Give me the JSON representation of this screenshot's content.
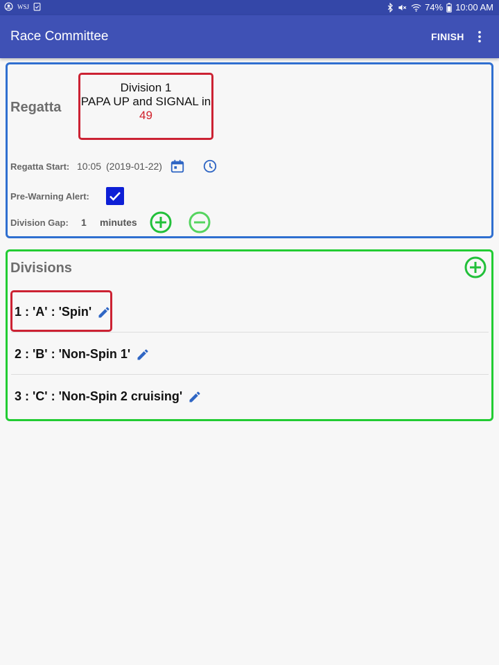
{
  "status_bar": {
    "wsj_label": "WSJ",
    "battery": "74%",
    "time": "10:00 AM"
  },
  "app_bar": {
    "title": "Race Committee",
    "finish_label": "FINISH"
  },
  "regatta": {
    "section_title": "Regatta",
    "signal_division": "Division 1",
    "signal_instruction": "PAPA UP and SIGNAL in",
    "signal_countdown": "49",
    "start_label": "Regatta Start:",
    "start_time": "10:05",
    "start_date": "(2019-01-22)",
    "pre_warning_label": "Pre-Warning Alert:",
    "pre_warning_checked": true,
    "gap_label": "Division Gap:",
    "gap_value": "1",
    "gap_unit": "minutes"
  },
  "divisions": {
    "section_title": "Divisions",
    "items": [
      {
        "label": "1 : 'A' : 'Spin'"
      },
      {
        "label": "2 : 'B' : 'Non-Spin 1'"
      },
      {
        "label": "3 : 'C' : 'Non-Spin 2 cruising'"
      }
    ]
  },
  "colors": {
    "status_bar": "#3447a8",
    "app_bar": "#3f51b5",
    "regatta_border": "#2f6fd0",
    "divisions_border": "#22cc33",
    "highlight_red": "#cc2233",
    "add_green": "#22c03a",
    "checkbox_blue": "#0d1fd6",
    "edit_blue": "#2f66c4"
  },
  "icons": {
    "account": "account-circle-icon",
    "clipboard": "clipboard-check-icon",
    "bluetooth": "bluetooth-icon",
    "mute": "mute-icon",
    "wifi": "wifi-icon",
    "battery": "battery-icon",
    "overflow": "more-vert-icon",
    "calendar": "calendar-icon",
    "clock": "clock-icon",
    "add": "add-circle-icon",
    "remove": "remove-circle-icon",
    "edit": "pencil-icon"
  }
}
